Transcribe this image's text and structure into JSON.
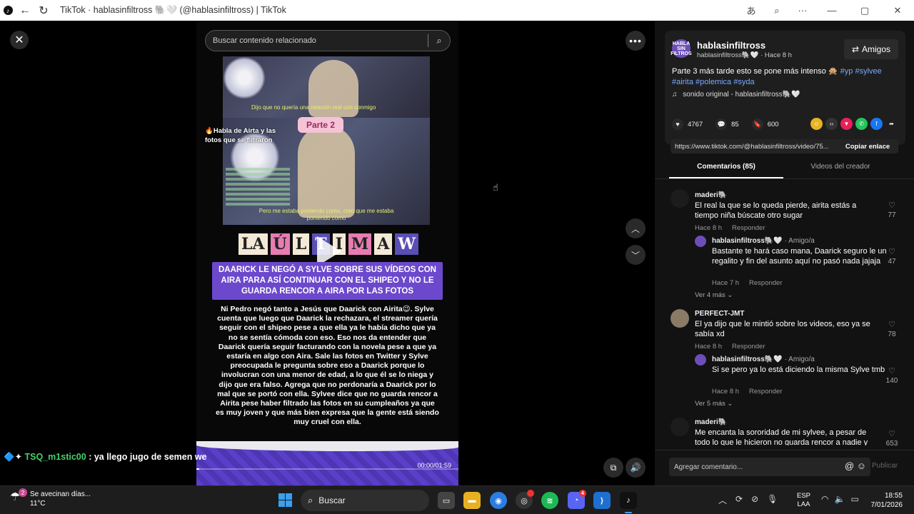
{
  "titlebar": {
    "title": "TikTok · hablasinfiltross 🐘🤍 (@hablasinfiltross) | TikTok"
  },
  "search": {
    "placeholder": "Buscar contenido relacionado"
  },
  "video": {
    "caption1": "Dijo que no quería una relación real con conmigo",
    "parte": "Parte 2",
    "fire_label": "🔥Habla de Airta y las fotos que se filtraron",
    "caption2": "Pero me estaba poniendo como, creo que me estaba poniendo como",
    "ultima": [
      "LA",
      "Ú",
      "L",
      "T",
      "I",
      "M",
      "A",
      "W"
    ],
    "banner": "DAARICK LE NEGÓ A SYLVE SOBRE SUS VÍDEOS CON AIRA PARA ASÍ CONTINUAR CON EL SHIPEO Y NO LE GUARDA RENCOR A AIRA POR LAS FOTOS",
    "body": "Ni Pedro negó tanto a Jesús que Daarick con Airita😉. Sylve cuenta que luego que Daarick la rechazara, el streamer quería seguir con el shipeo pese a que ella ya le había dicho que ya no se sentía cómoda con eso. Eso nos da entender que Daarick quería seguir facturando con la novela pese a que ya estaría en algo con Aira. Sale las fotos en Twitter y Sylve preocupada le pregunta sobre eso a Daarick porque lo involucran con una menor de edad, a lo que él se lo niega y dijo que era falso. Agrega que no perdonaría a Daarick por lo mal que se portó con ella. Sylvee dice que no guarda rencor a Airita pese haber filtrado las fotos en su cumpleaños ya que es muy joven y que más bien expresa que la gente está siendo muy cruel con ella.",
    "time": "00:00/01:59",
    "progress": 0.01,
    "chat_user": "TSQ_m1stic00",
    "chat_msg": ": ya llego jugo de semen we"
  },
  "creator": {
    "avatar_text": "HABLA SIN FILTROS",
    "handle": "hablasinfiltross",
    "sub": "hablasinfiltross🐘🤍 · Hace 8 h",
    "amigos": "Amigos",
    "desc": "Parte 3 más tarde esto se pone más intenso 🙊",
    "tags": [
      "#yp",
      "#sylvee",
      "#airita",
      "#polemica",
      "#syda"
    ],
    "music": "sonido original - hablasinfiltross🐘🤍"
  },
  "stats": {
    "likes": "4767",
    "comments": "85",
    "saves": "600"
  },
  "link": {
    "url": "https://www.tiktok.com/@hablasinfiltross/video/75...",
    "copy": "Copiar enlace"
  },
  "tabs": {
    "comments": "Comentarios (85)",
    "creator": "Videos del creador"
  },
  "comments": [
    {
      "user": "maderi🐘",
      "text": "El real la que se lo queda pierde, airita estás a tiempo niña búscate otro sugar",
      "time": "Hace 8 h",
      "reply": "Responder",
      "likes": "77"
    },
    {
      "user": "hablasinfiltross🐘🤍",
      "tag": " · Amigo/a",
      "text": "Bastante te hará caso mana, Daarick seguro le un regalito y fin del asunto aquí no pasó nada jajaja",
      "time": "Hace 7 h",
      "reply": "Responder",
      "likes": "47"
    },
    {
      "more": "Ver 4 más"
    },
    {
      "user": "PERFECT-JMT",
      "text": "El ya dijo que le mintió sobre los videos, eso ya se sabía xd",
      "time": "Hace 8 h",
      "reply": "Responder",
      "likes": "78"
    },
    {
      "user": "hablasinfiltross🐘🤍",
      "tag": " · Amigo/a",
      "text": "Si se pero ya lo está diciendo la misma Sylve tmb",
      "time": "Hace 8 h",
      "reply": "Responder",
      "likes": "140"
    },
    {
      "more": "Ver 5 más"
    },
    {
      "user": "maderi🐘",
      "text": "Me encanta la sororidad de mi sylvee, a pesar de todo lo que le hicieron no guarda rencor a nadie y",
      "likes": "653"
    }
  ],
  "add_comment": {
    "placeholder": "Agregar comentario...",
    "publish": "Publicar"
  },
  "taskbar": {
    "weather_title": "Se avecinan días...",
    "weather_temp": "11°C",
    "weather_badge": "2",
    "search": "Buscar",
    "lang1": "ESP",
    "lang2": "LAA",
    "time": "18:55",
    "date": "7/01/2026",
    "discord_badge": "4"
  }
}
